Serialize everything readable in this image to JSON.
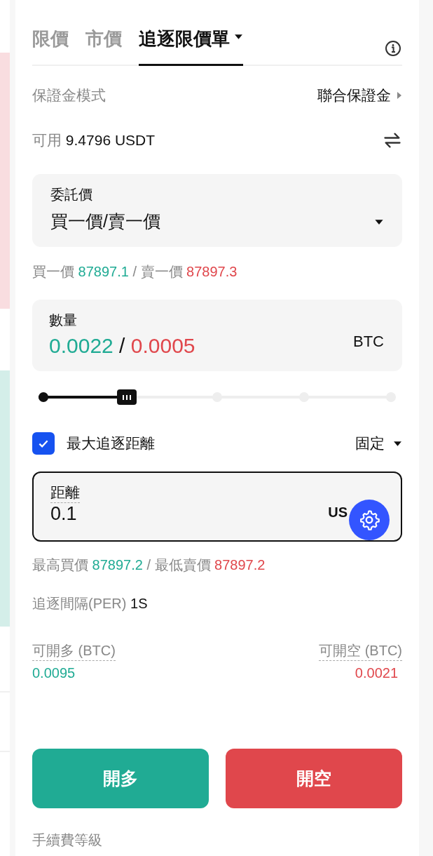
{
  "order_tabs": [
    {
      "label": "限價",
      "selected": false,
      "kind": "plain"
    },
    {
      "label": "市價",
      "selected": false,
      "kind": "plain"
    },
    {
      "label": "追逐限價單",
      "selected": true,
      "kind": "dropdown"
    }
  ],
  "margin_mode": {
    "label": "保證金模式",
    "value": "聯合保證金"
  },
  "available": {
    "label": "可用",
    "value": "9.4796 USDT"
  },
  "order_price": {
    "label": "委託價",
    "value": "買一價/賣一價"
  },
  "quotes": {
    "bid_label": "買一價",
    "bid": "87897.1",
    "separator": "/",
    "ask_label": "賣一價",
    "ask": "87897.3"
  },
  "quantity": {
    "label": "數量",
    "long_value": "0.0022",
    "separator": "/",
    "short_value": "0.0005",
    "unit": "BTC"
  },
  "slider": {
    "level": 0.24
  },
  "max_chase": {
    "label": "最大追逐距離",
    "checked": true,
    "mode": "固定"
  },
  "distance": {
    "label": "距離",
    "value": "0.1",
    "unit": "US"
  },
  "limits": {
    "bid_label": "最高買價",
    "bid": "87897.2",
    "separator": "/",
    "ask_label": "最低賣價",
    "ask": "87897.2"
  },
  "interval": {
    "label": "追逐間隔(PER)",
    "value": "1S"
  },
  "max_open": [
    {
      "label": "可開多 (BTC)",
      "value": "0.0095",
      "color": "#20ab94"
    },
    {
      "label": "可開空 (BTC)",
      "value": "0.0021",
      "color": "#e0474c"
    }
  ],
  "buttons": [
    {
      "label": "開多",
      "color": "#20ab94"
    },
    {
      "label": "開空",
      "color": "#e0474c"
    }
  ],
  "fee_level": {
    "label": "手續費等級"
  }
}
